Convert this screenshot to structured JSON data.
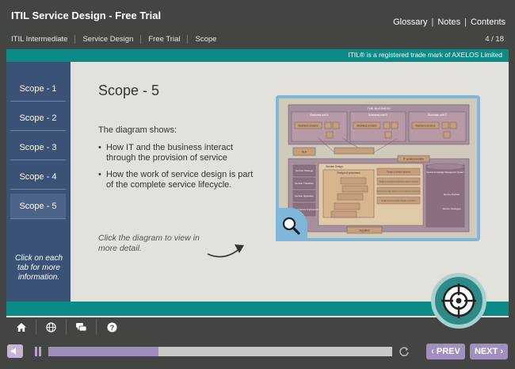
{
  "header": {
    "title": "ITIL Service Design - Free Trial",
    "links": [
      "Glossary",
      "Notes",
      "Contents"
    ],
    "breadcrumb": [
      "ITIL Intermediate",
      "Service Design",
      "Free Trial",
      "Scope"
    ],
    "page_counter": "4 / 18"
  },
  "trademark": "ITIL® is a registered trade mark of AXELOS Limited",
  "sidebar": {
    "tabs": [
      "Scope - 1",
      "Scope - 2",
      "Scope - 3",
      "Scope - 4",
      "Scope - 5"
    ],
    "active_index": 4,
    "hint": "Click on each tab for more information."
  },
  "content": {
    "heading": "Scope - 5",
    "intro": "The diagram shows:",
    "bullets": [
      "How IT and the business interact through the provision of service",
      "How the work of service design is part of the complete service lifecycle."
    ],
    "click_note": "Click the diagram to view in more detail."
  },
  "diagram": {
    "business_label": "THE BUSINESS",
    "units": [
      "Business unit A",
      "Business unit B",
      "Business unit C"
    ],
    "process_label": "Business process",
    "sla_label": "SLA",
    "provider_label": "IT service provider",
    "left_boxes": [
      "Service Strategy",
      "Service Transition",
      "Service Operation",
      "Continual Service Improvement"
    ],
    "service_design_label": "Service Design",
    "design_processes_label": "Design of processes",
    "design_solutions": [
      "Design of service solutions",
      "Design of management information systems and tools",
      "Design of technology architecture and management architectures",
      "Design of measurement methods and metrics"
    ],
    "skms_label": "Service Knowledge Management System",
    "portfolio_labels": [
      "Service Portfolio",
      "Service Catalogue"
    ],
    "suppliers_label": "Suppliers",
    "colors": {
      "box": "#c79e7a",
      "panel": "#a6909e",
      "border": "#6e5a6a"
    }
  },
  "toolbar": {
    "icons": [
      "home-icon",
      "globe-icon",
      "chat-icon",
      "help-icon"
    ]
  },
  "media": {
    "progress": 0.32,
    "prev_label": "PREV",
    "next_label": "NEXT"
  },
  "colors": {
    "teal": "#0b8a86",
    "sidebar": "#3a5276",
    "nav_button": "#a18fbd"
  }
}
